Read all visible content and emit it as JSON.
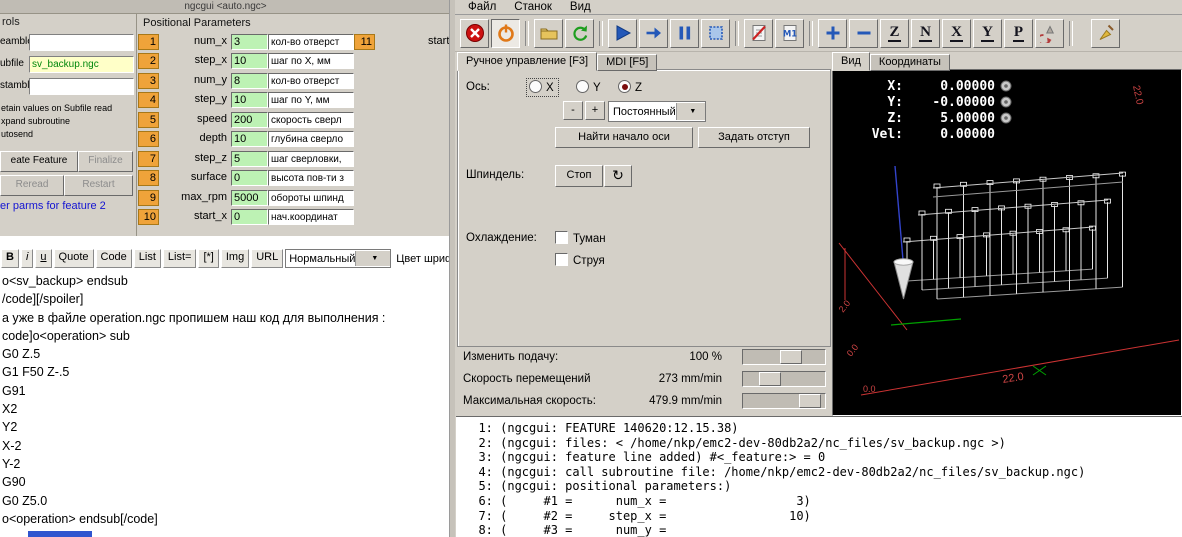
{
  "ngcgui": {
    "title": "ngcgui  <auto.ngc>",
    "controls": {
      "header": "rols",
      "preamble_label": "eamble",
      "preamble_value": "",
      "subfile_label": "ubfile",
      "subfile_value": "sv_backup.ngc",
      "postamble_label": "stamble",
      "postamble_value": "",
      "opt_retain": "etain values on Subfile read",
      "opt_expand": "xpand subroutine",
      "opt_autosend": "utosend",
      "create_btn": "eate Feature",
      "finalize_btn": "Finalize",
      "reread_btn": "Reread",
      "restart_btn": "Restart",
      "status_link": "er parms for feature 2"
    },
    "positional": {
      "header": "Positional Parameters",
      "rows": [
        {
          "n": "1",
          "name": "num_x",
          "value": "3",
          "desc": "кол-во отверст"
        },
        {
          "n": "2",
          "name": "step_x",
          "value": "10",
          "desc": "шаг по X, мм"
        },
        {
          "n": "3",
          "name": "num_y",
          "value": "8",
          "desc": "кол-во отверст"
        },
        {
          "n": "4",
          "name": "step_y",
          "value": "10",
          "desc": "шаг по Y, мм"
        },
        {
          "n": "5",
          "name": "speed",
          "value": "200",
          "desc": "скорость сверл"
        },
        {
          "n": "6",
          "name": "depth",
          "value": "10",
          "desc": "глубина сверло"
        },
        {
          "n": "7",
          "name": "step_z",
          "value": "5",
          "desc": "шаг сверловки,"
        },
        {
          "n": "8",
          "name": "surface",
          "value": "0",
          "desc": "высота пов-ти з"
        },
        {
          "n": "9",
          "name": "max_rpm",
          "value": "5000",
          "desc": "обороты шпинд"
        },
        {
          "n": "10",
          "name": "start_x",
          "value": "0",
          "desc": "нач.координат"
        }
      ],
      "extra_num": "11",
      "extra_name": "start_y"
    }
  },
  "editor": {
    "buttons": [
      "B",
      "i",
      "u",
      "Quote",
      "Code",
      "List",
      "List=",
      "[*]",
      "Img",
      "URL"
    ],
    "style_select": "Нормальный",
    "dropdown_arrow": "▼",
    "font_color_label": "Цвет шриф"
  },
  "forum": {
    "lines": [
      "o<sv_backup> endsub",
      "/code][/spoiler]",
      "а уже в файле operation.ngc пропишем наш код для выполнения :",
      "code]o<operation> sub",
      "G0 Z.5",
      "G1 F50 Z-.5",
      "G91",
      "X2",
      "Y2",
      "X-2",
      "Y-2",
      "G90",
      "G0 Z5.0",
      "o<operation> endsub[/code]"
    ]
  },
  "axis": {
    "menu": [
      "Файл",
      "Станок",
      "Вид"
    ],
    "view_letters": [
      "Z",
      "N",
      "X",
      "Y",
      "P"
    ],
    "m1_label": "M1",
    "tabs": {
      "manual": "Ручное управление [F3]",
      "mdi": "MDI [F5]",
      "view": "Вид",
      "coords": "Координаты"
    },
    "manual": {
      "axis_label": "Ось:",
      "axis_x": "X",
      "axis_y": "Y",
      "axis_z": "Z",
      "minus": "-",
      "plus": "+",
      "jog_mode": "Постоянный",
      "dropdown_arrow": "▼",
      "home_btn": "Найти начало оси",
      "offset_btn": "Задать отступ",
      "spindle_label": "Шпиндель:",
      "spindle_stop": "Стоп",
      "spindle_turn_glyph": "↻",
      "coolant_label": "Охлаждение:",
      "mist": "Туман",
      "flood": "Струя"
    },
    "sliders": [
      {
        "label": "Изменить подачу:",
        "value": "100 %",
        "pos": 62
      },
      {
        "label": "Скорость перемещений",
        "value": "273 mm/min",
        "pos": 26
      },
      {
        "label": "Максимальная скорость:",
        "value": "479.9 mm/min",
        "pos": 93
      }
    ],
    "dro": {
      "x_label": "X:",
      "x": "0.00000",
      "y_label": "Y:",
      "y": "-0.00000",
      "z_label": "Z:",
      "z": "5.00000",
      "vel_label": "Vel:",
      "vel": "0.00000"
    },
    "view_dims": {
      "bottom": "22.0",
      "right": "22.0",
      "left": "2.0",
      "o1": "0.0",
      "o2": "0.0"
    },
    "code_lines": [
      "  1: (ngcgui: FEATURE 140620:12.15.38)",
      "  2: (ngcgui: files: < /home/nkp/emc2-dev-80db2a2/nc_files/sv_backup.ngc >)",
      "  3: (ngcgui: feature line added) #<_feature:> = 0",
      "  4: (ngcgui: call subroutine file: /home/nkp/emc2-dev-80db2a2/nc_files/sv_backup.ngc)",
      "  5: (ngcgui: positional parameters:)",
      "  6: (     #1 =      num_x =                  3)",
      "  7: (     #2 =     step_x =                 10)",
      "  8: (     #3 =      num_y ="
    ]
  }
}
